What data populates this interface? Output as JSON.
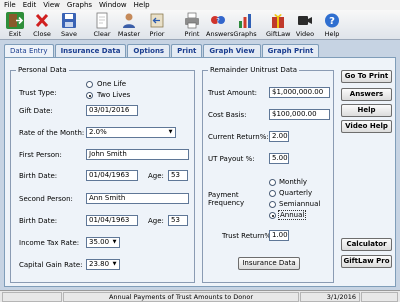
{
  "menu": [
    "File",
    "Edit",
    "View",
    "Graphs",
    "Window",
    "Help"
  ],
  "toolbar": [
    {
      "label": "Exit",
      "icon": "exit-door-icon"
    },
    {
      "label": "Close",
      "icon": "close-x-icon"
    },
    {
      "label": "Save",
      "icon": "save-disk-icon"
    },
    {
      "label": "Clear",
      "icon": "clear-page-icon"
    },
    {
      "label": "Master",
      "icon": "master-person-icon"
    },
    {
      "label": "Prior",
      "icon": "prior-arrow-icon"
    },
    {
      "label": "Print",
      "icon": "printer-icon"
    },
    {
      "label": "Answers",
      "icon": "answers-icon"
    },
    {
      "label": "Graphs",
      "icon": "graphs-icon"
    },
    {
      "label": "GiftLaw",
      "icon": "giftlaw-icon"
    },
    {
      "label": "Video",
      "icon": "video-icon"
    },
    {
      "label": "Help",
      "icon": "help-icon"
    }
  ],
  "tabs": [
    "Data Entry",
    "Insurance Data",
    "Options",
    "Print",
    "Graph View",
    "Graph Print"
  ],
  "personal": {
    "title": "Personal Data",
    "trust_type_label": "Trust Type:",
    "one_life": "One Life",
    "two_lives": "Two Lives",
    "trust_type_selected": "Two Lives",
    "gift_date_label": "Gift Date:",
    "gift_date": "03/01/2016",
    "rate_label": "Rate of the Month:",
    "rate": "2.0%",
    "first_person_label": "First Person:",
    "first_person": "John Smith",
    "birth_date_label": "Birth Date:",
    "birth_date_1": "01/04/1963",
    "age_label": "Age:",
    "age_1": "53",
    "second_person_label": "Second Person:",
    "second_person": "Ann Smith",
    "birth_date_2": "01/04/1963",
    "age_2": "53",
    "income_tax_label": "Income Tax Rate:",
    "income_tax": "35.00",
    "capital_gain_label": "Capital Gain Rate:",
    "capital_gain": "23.80"
  },
  "remainder": {
    "title": "Remainder Unitrust Data",
    "trust_amount_label": "Trust Amount:",
    "trust_amount": "$1,000,000.00",
    "cost_basis_label": "Cost Basis:",
    "cost_basis": "$100,000.00",
    "current_return_label": "Current Return%:",
    "current_return": "2.00",
    "ut_payout_label": "UT Payout %:",
    "ut_payout": "5.00",
    "payment_freq_label1": "Payment",
    "payment_freq_label2": "Frequency",
    "freq_options": [
      "Monthly",
      "Quarterly",
      "Semiannual",
      "Annual"
    ],
    "freq_selected": "Annual",
    "trust_return_label": "Trust Return%:",
    "trust_return": "1.00",
    "insurance_button": "Insurance Data"
  },
  "side_buttons": {
    "go_to_print": "Go To Print",
    "answers": "Answers",
    "help": "Help",
    "video_help": "Video Help",
    "calculator": "Calculator",
    "giftlaw_pro": "GiftLaw Pro"
  },
  "status": {
    "left": "",
    "message": "Annual Payments of Trust Amounts to Donor",
    "date": "3/1/2016",
    "extra": ""
  }
}
